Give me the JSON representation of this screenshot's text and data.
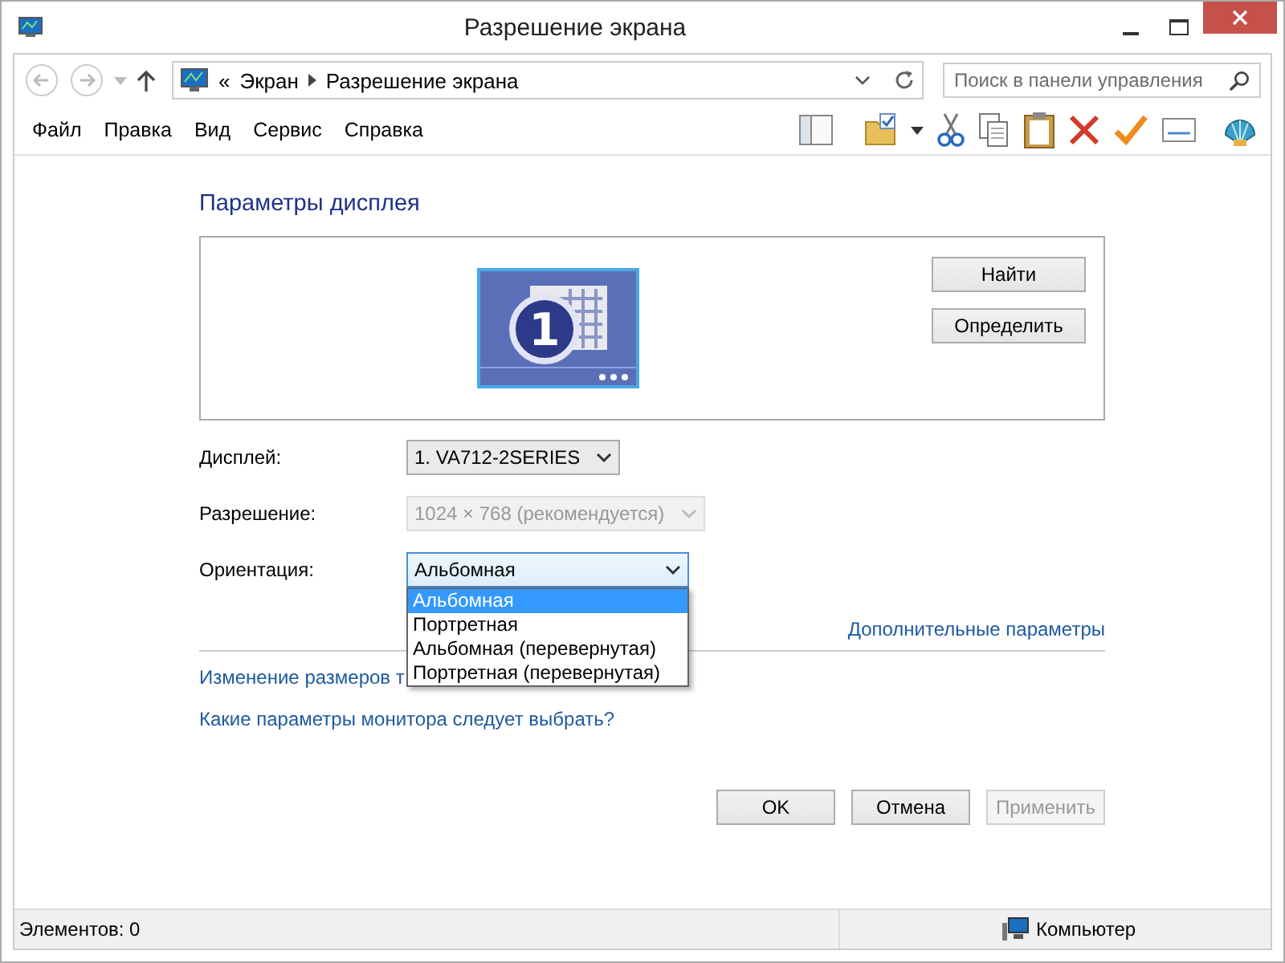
{
  "window": {
    "title": "Разрешение экрана"
  },
  "address": {
    "overflow": "«",
    "path": [
      "Экран",
      "Разрешение экрана"
    ],
    "search_placeholder": "Поиск в панели управления"
  },
  "menu": [
    "Файл",
    "Правка",
    "Вид",
    "Сервис",
    "Справка"
  ],
  "heading": "Параметры дисплея",
  "preview": {
    "monitor_number": "1",
    "buttons": [
      "Найти",
      "Определить"
    ]
  },
  "fields": [
    {
      "label": "Дисплей:",
      "value": "1. VA712-2SERIES",
      "disabled": false,
      "open": false
    },
    {
      "label": "Разрешение:",
      "value": "1024 × 768 (рекомендуется)",
      "disabled": true,
      "open": false
    },
    {
      "label": "Ориентация:",
      "value": "Альбомная",
      "disabled": false,
      "open": true,
      "options": [
        {
          "label": "Альбомная",
          "selected": true
        },
        {
          "label": "Портретная",
          "selected": false
        },
        {
          "label": "Альбомная (перевернутая)",
          "selected": false
        },
        {
          "label": "Портретная (перевернутая)",
          "selected": false
        }
      ]
    }
  ],
  "advanced_link": "Дополнительные параметры",
  "links": [
    "Изменение размеров т",
    "Какие параметры монитора следует выбрать?"
  ],
  "buttons": [
    {
      "label": "OK",
      "disabled": false
    },
    {
      "label": "Отмена",
      "disabled": false
    },
    {
      "label": "Применить",
      "disabled": true
    }
  ],
  "status_bar": {
    "items": "Элементов: 0",
    "location": "Компьютер"
  }
}
